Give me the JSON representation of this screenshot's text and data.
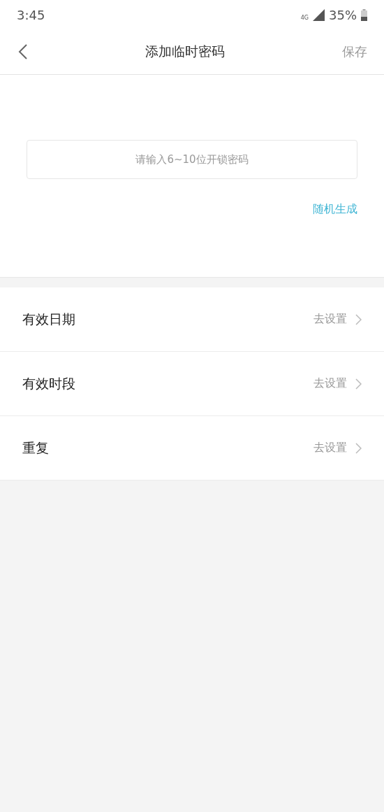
{
  "status_bar": {
    "time": "3:45",
    "network": "4G",
    "battery": "35%"
  },
  "header": {
    "title": "添加临时密码",
    "action": "保存"
  },
  "password_field": {
    "placeholder": "请输入6~10位开锁密码"
  },
  "random_link": "随机生成",
  "settings": [
    {
      "label": "有效日期",
      "value": "去设置"
    },
    {
      "label": "有效时段",
      "value": "去设置"
    },
    {
      "label": "重复",
      "value": "去设置"
    }
  ]
}
